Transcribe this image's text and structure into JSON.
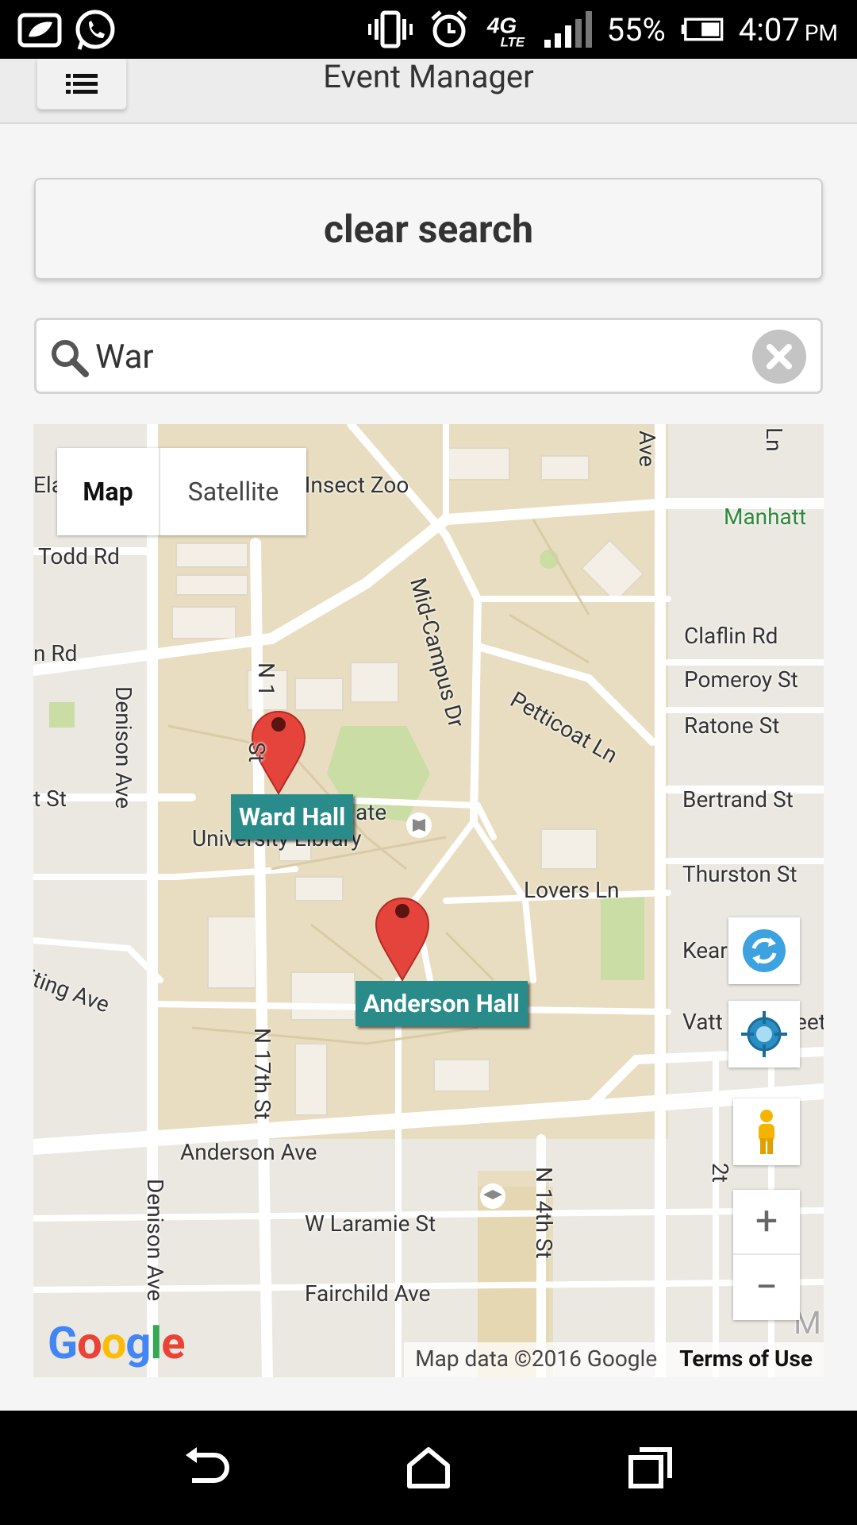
{
  "status_bar": {
    "battery_percent": "55%",
    "time": "4:07",
    "ampm": "PM",
    "network": "4G LTE"
  },
  "header": {
    "title": "Event Manager"
  },
  "actions": {
    "clear_search_label": "clear search"
  },
  "search": {
    "value": "War"
  },
  "map": {
    "type_options": [
      "Map",
      "Satellite"
    ],
    "selected_type": "Map",
    "street_labels": [
      "Ela",
      "e Insect Zoo",
      "Manhatt",
      "Todd Rd",
      "Claflin Rd",
      "n Rd",
      "Pomeroy St",
      "Ratone St",
      "Petticoat Ln",
      "Mid-Campus Dr",
      "Denison Ave",
      "t St",
      "Bertrand St",
      "ate",
      "University Library",
      "Thurston St",
      "Lovers Ln",
      "Kear",
      "iting Ave",
      "Vatt",
      "eet",
      "N 17th St",
      "Anderson Ave",
      "W Laramie St",
      "N 14th St",
      "Fairchild Ave",
      "Denison Ave",
      "Ave",
      "Ln",
      "N 1",
      "St",
      "2t",
      "M"
    ],
    "markers": [
      {
        "label": "Ward Hall"
      },
      {
        "label": "Anderson Hall"
      }
    ],
    "attribution": "Map data ©2016 Google",
    "terms_label": "Terms of Use",
    "logo_text": "Google",
    "zoom_in_label": "+",
    "zoom_out_label": "−"
  },
  "colors": {
    "marker_label_bg": "#2a8b8b",
    "map_land": "#e8ddc0",
    "marker_pin": "#e5443c"
  }
}
